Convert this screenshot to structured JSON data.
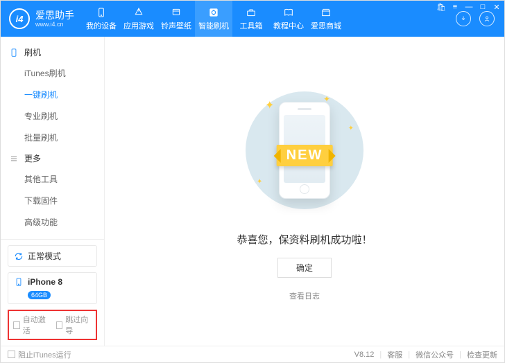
{
  "brand": {
    "name": "爱思助手",
    "url": "www.i4.cn",
    "logo_text": "i4"
  },
  "nav": [
    {
      "label": "我的设备",
      "icon": "phone"
    },
    {
      "label": "应用游戏",
      "icon": "apps"
    },
    {
      "label": "铃声壁纸",
      "icon": "ringtone"
    },
    {
      "label": "智能刷机",
      "icon": "flash",
      "active": true
    },
    {
      "label": "工具箱",
      "icon": "toolbox"
    },
    {
      "label": "教程中心",
      "icon": "book"
    },
    {
      "label": "爱思商城",
      "icon": "store"
    }
  ],
  "window_controls": {
    "menu": "≡",
    "min": "—",
    "max": "□",
    "close": "✕",
    "cart": "🛍"
  },
  "sidebar": {
    "group_flash": {
      "label": "刷机"
    },
    "flash_items": [
      {
        "label": "iTunes刷机"
      },
      {
        "label": "一键刷机",
        "active": true
      },
      {
        "label": "专业刷机"
      },
      {
        "label": "批量刷机"
      }
    ],
    "group_more": {
      "label": "更多"
    },
    "more_items": [
      {
        "label": "其他工具"
      },
      {
        "label": "下载固件"
      },
      {
        "label": "高级功能"
      }
    ],
    "mode": {
      "label": "正常模式"
    },
    "device": {
      "name": "iPhone 8",
      "storage": "64GB"
    },
    "checks": {
      "auto_activate": "自动激活",
      "skip_wizard": "跳过向导"
    }
  },
  "main": {
    "ribbon": "NEW",
    "message": "恭喜您，保资料刷机成功啦！",
    "ok": "确定",
    "view_log": "查看日志"
  },
  "footer": {
    "block_itunes": "阻止iTunes运行",
    "version": "V8.12",
    "support": "客服",
    "wechat": "微信公众号",
    "check_update": "检查更新"
  }
}
